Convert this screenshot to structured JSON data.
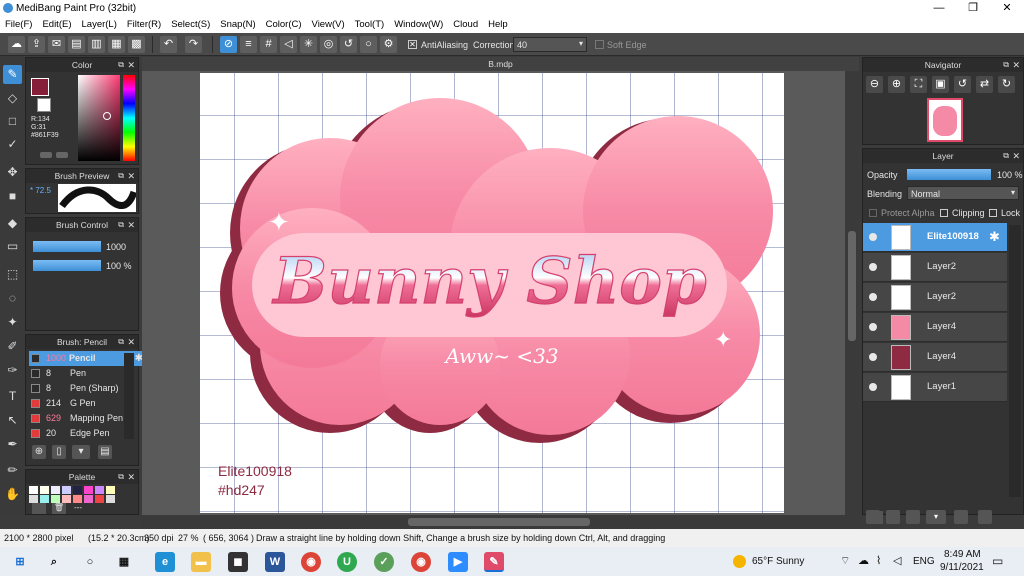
{
  "window": {
    "title": "MediBang Paint Pro (32bit)",
    "min": "—",
    "max": "❐",
    "close": "✕"
  },
  "menu": [
    "File(F)",
    "Edit(E)",
    "Layer(L)",
    "Filter(R)",
    "Select(S)",
    "Snap(N)",
    "Color(C)",
    "View(V)",
    "Tool(T)",
    "Window(W)",
    "Cloud",
    "Help"
  ],
  "toolbar": {
    "antialias_label": "AntiAliasing",
    "correction_label": "Correction",
    "correction_value": "40",
    "soft_edge_label": "Soft Edge"
  },
  "color_panel": {
    "title": "Color",
    "r": "R:134",
    "g": "G:31",
    "hex": "#861F39",
    "primary": "#861f39"
  },
  "brush_preview": {
    "title": "Brush Preview",
    "value": "* 72.5"
  },
  "brush_control": {
    "title": "Brush Control",
    "size": "1000",
    "opacity": "100 %"
  },
  "brush_list": {
    "title": "Brush: Pencil",
    "items": [
      {
        "size": "1000",
        "name": "Pencil",
        "color": "#2b2b2b"
      },
      {
        "size": "8",
        "name": "Pen",
        "color": "#2b2b2b"
      },
      {
        "size": "8",
        "name": "Pen (Sharp)",
        "color": "#2b2b2b"
      },
      {
        "size": "214",
        "name": "G Pen",
        "color": "#e23b3b"
      },
      {
        "size": "629",
        "name": "Mapping Pen",
        "color": "#e23b3b"
      },
      {
        "size": "20",
        "name": "Edge Pen",
        "color": "#e23b3b"
      }
    ]
  },
  "palette": {
    "title": "Palette",
    "footer": "---"
  },
  "document": {
    "tab": "B.mdp"
  },
  "artwork": {
    "title_text": "Bunny Shop",
    "subtitle_text": "Aww~ <33",
    "watermark_line1": "Elite100918",
    "watermark_line2": "#hd247"
  },
  "navigator": {
    "title": "Navigator"
  },
  "layer_panel": {
    "title": "Layer",
    "opacity_label": "Opacity",
    "opacity_value": "100 %",
    "blending_label": "Blending",
    "blending_value": "Normal",
    "protect_alpha": "Protect Alpha",
    "clipping": "Clipping",
    "lock": "Lock",
    "layers": [
      "Elite100918",
      "Layer2",
      "Layer2",
      "Layer4",
      "Layer4",
      "Layer1"
    ]
  },
  "status": {
    "size": "2100 * 2800 pixel",
    "cm": "(15.2 * 20.3cm)",
    "dpi": "350 dpi",
    "zoom": "27 %",
    "coords": "( 656, 3064 )",
    "hint": "Draw a straight line by holding down Shift, Change a brush size by holding down Ctrl, Alt, and dragging"
  },
  "taskbar": {
    "weather": "65°F  Sunny",
    "lang": "ENG",
    "time": "8:49 AM",
    "date": "9/11/2021"
  },
  "colors": {
    "accent": "#3e8fd6",
    "pink": "#f48aa6",
    "dark_pink": "#8e2a41"
  }
}
